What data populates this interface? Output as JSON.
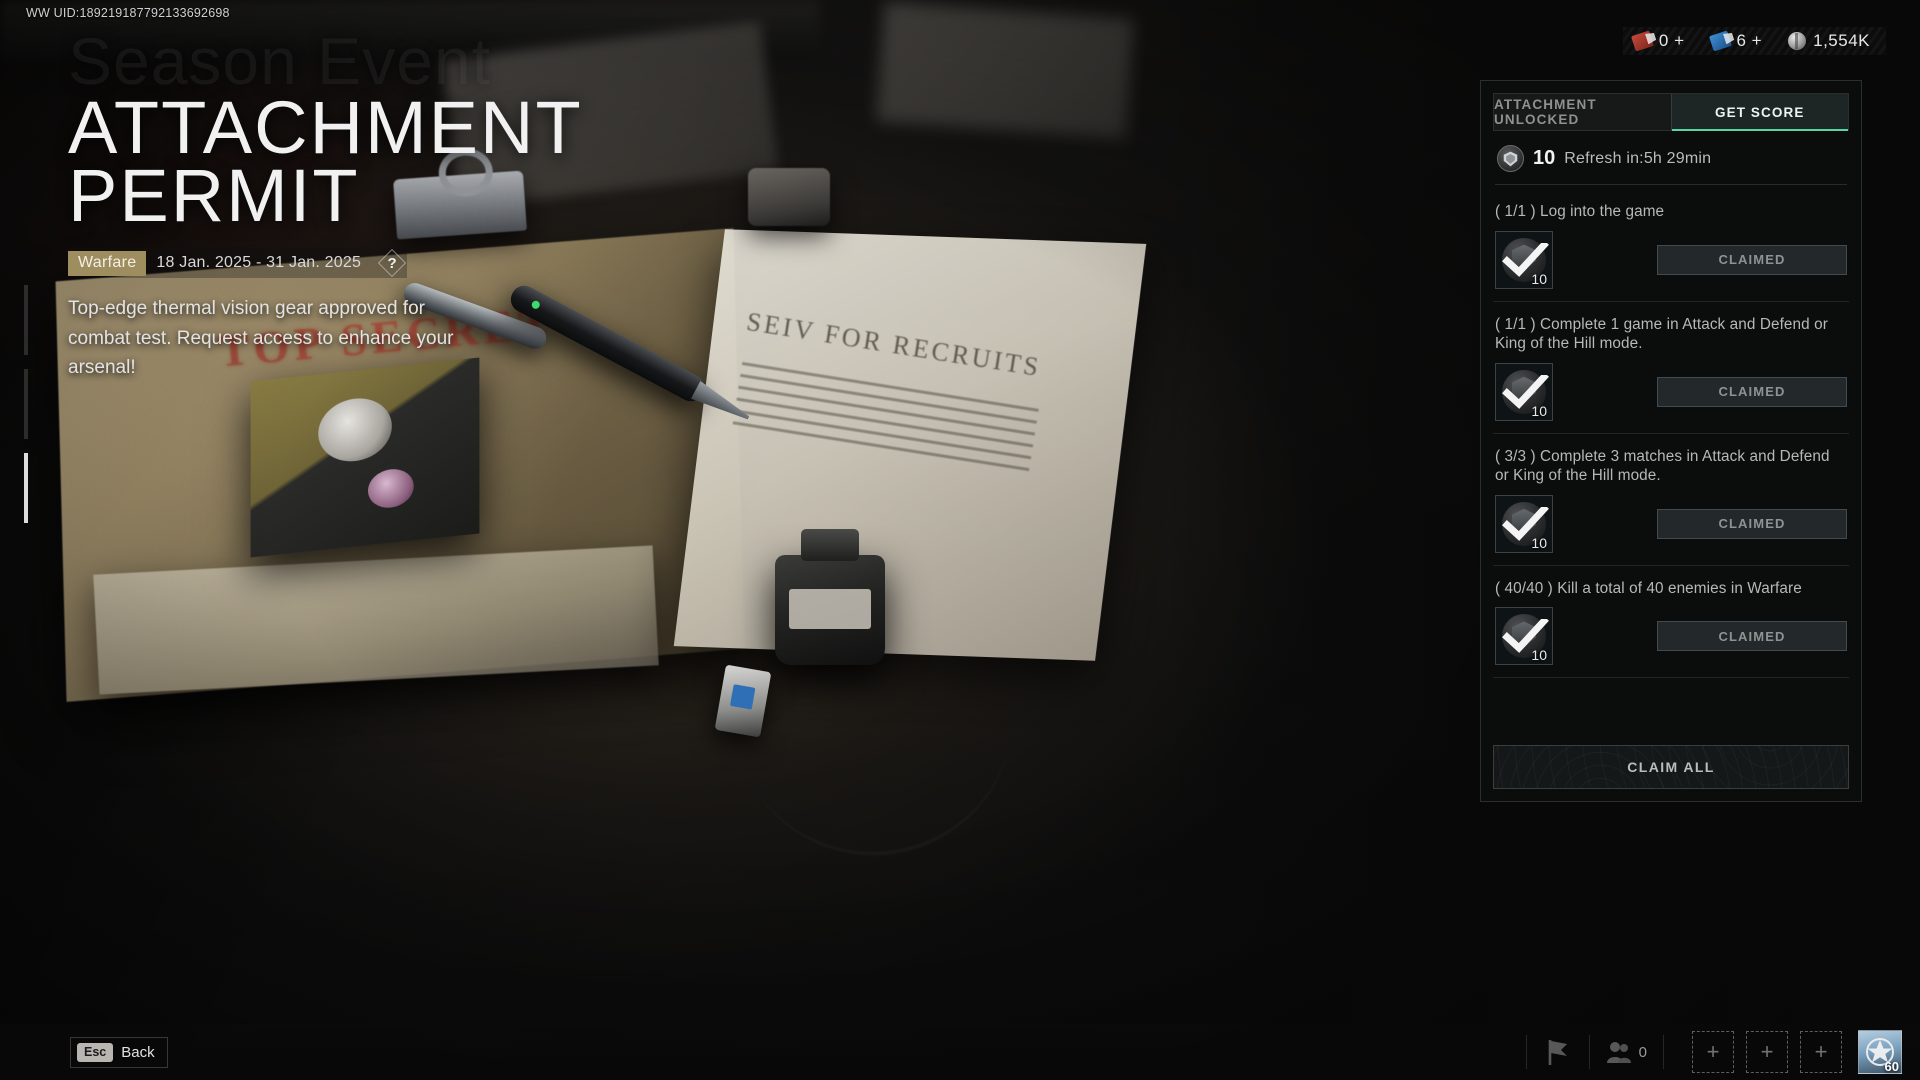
{
  "uid": "WW UID:189219187792133692698",
  "currency": [
    {
      "icon": "red-ticket-icon",
      "value": "0 +"
    },
    {
      "icon": "blue-ticket-icon",
      "value": "6 +"
    },
    {
      "icon": "silver-coin-icon",
      "value": "1,554K"
    }
  ],
  "hero": {
    "ghost_title": "Season Event",
    "title_line1": "ATTACHMENT",
    "title_line2": "PERMIT",
    "mode_badge": "Warfare",
    "date_range": "18 Jan. 2025 - 31 Jan. 2025",
    "help_glyph": "?",
    "description": "Top-edge thermal vision gear approved for combat test. Request access to enhance your arsenal!"
  },
  "panel": {
    "tabs": [
      {
        "label": "ATTACHMENT UNLOCKED",
        "active": false
      },
      {
        "label": "GET SCORE",
        "active": true
      }
    ],
    "score_value": "10",
    "refresh_text": "Refresh in:5h 29min",
    "accent_color": "#55d6a2",
    "tasks": [
      {
        "progress": "( 1/1 )",
        "text": "( 1/1 ) Log into the game",
        "reward_qty": "10",
        "button": "CLAIMED"
      },
      {
        "progress": "( 1/1 )",
        "text": "( 1/1 ) Complete 1 game in Attack and Defend or King of the Hill mode.",
        "reward_qty": "10",
        "button": "CLAIMED"
      },
      {
        "progress": "( 3/3 )",
        "text": "( 3/3 ) Complete 3 matches in Attack and Defend or King of the Hill mode.",
        "reward_qty": "10",
        "button": "CLAIMED"
      },
      {
        "progress": "( 40/40 )",
        "text": "( 40/40 ) Kill a total of 40 enemies in Warfare",
        "reward_qty": "10",
        "button": "CLAIMED"
      }
    ],
    "claim_all_label": "CLAIM ALL"
  },
  "scene": {
    "stamp_text": "TOP SECRET",
    "letter_heading": "SEIV FOR RECRUITS"
  },
  "bottom_bar": {
    "esc_key": "Esc",
    "esc_label": "Back",
    "friends_count": "0",
    "slot_glyph": "+",
    "player_level": "60"
  }
}
